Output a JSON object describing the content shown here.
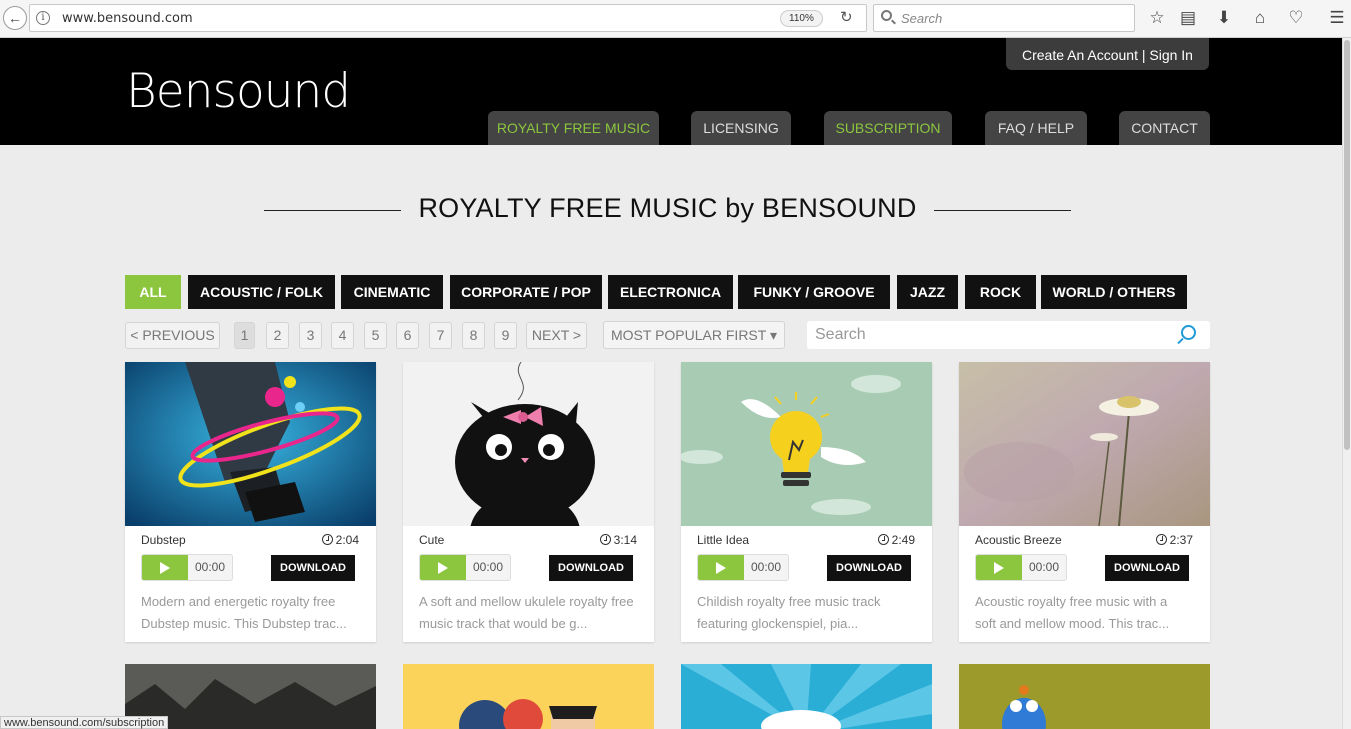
{
  "browser": {
    "url": "www.bensound.com",
    "zoom": "110%",
    "search_placeholder": "Search",
    "status_url": "www.bensound.com/subscription"
  },
  "header": {
    "logo": "Bensound",
    "account_link": "Create An Account | Sign In",
    "nav": [
      "ROYALTY FREE MUSIC",
      "LICENSING",
      "SUBSCRIPTION",
      "FAQ / HELP",
      "CONTACT"
    ]
  },
  "main": {
    "heading": "ROYALTY FREE MUSIC by BENSOUND",
    "categories": [
      "ALL",
      "ACOUSTIC / FOLK",
      "CINEMATIC",
      "CORPORATE / POP",
      "ELECTRONICA",
      "FUNKY / GROOVE",
      "JAZZ",
      "ROCK",
      "WORLD / OTHERS"
    ],
    "pagination": {
      "previous": "< PREVIOUS",
      "pages": [
        "1",
        "2",
        "3",
        "4",
        "5",
        "6",
        "7",
        "8",
        "9"
      ],
      "next": "NEXT >"
    },
    "sort_label": "MOST POPULAR FIRST",
    "search_placeholder": "Search"
  },
  "tracks": [
    {
      "title": "Dubstep",
      "duration": "2:04",
      "time": "00:00",
      "download": "DOWNLOAD",
      "desc_line1": "Modern and energetic royalty free",
      "desc_line2": "Dubstep music. This Dubstep trac..."
    },
    {
      "title": "Cute",
      "duration": "3:14",
      "time": "00:00",
      "download": "DOWNLOAD",
      "desc_line1": "A soft and mellow ukulele royalty free",
      "desc_line2": "music track that would be g..."
    },
    {
      "title": "Little Idea",
      "duration": "2:49",
      "time": "00:00",
      "download": "DOWNLOAD",
      "desc_line1": "Childish royalty free music track",
      "desc_line2": "featuring glockenspiel, pia..."
    },
    {
      "title": "Acoustic Breeze",
      "duration": "2:37",
      "time": "00:00",
      "download": "DOWNLOAD",
      "desc_line1": "Acoustic royalty free music with a",
      "desc_line2": "soft and mellow mood. This trac..."
    }
  ],
  "colors": {
    "accent": "#8cc63f",
    "header_bg": "#000000",
    "page_bg": "#ececec",
    "link_blue": "#1e9bd7"
  }
}
